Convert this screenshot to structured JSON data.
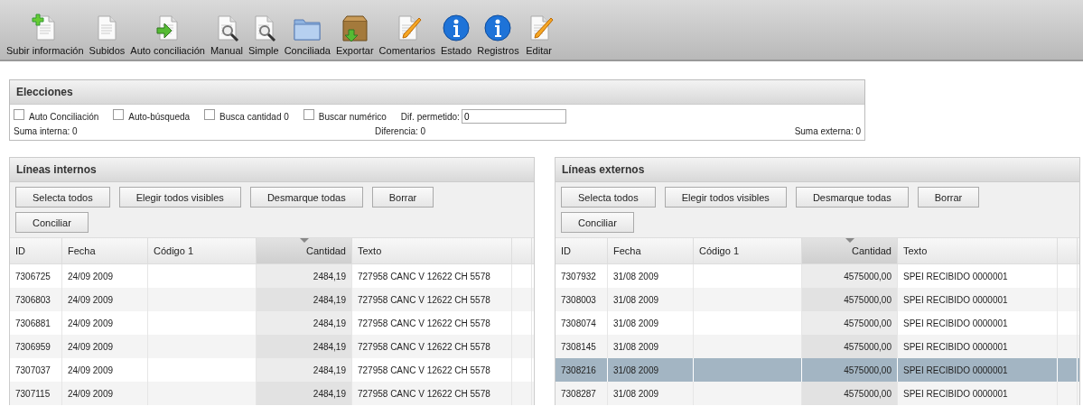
{
  "toolbar": [
    {
      "label": "Subir información",
      "kind": "doc-plus"
    },
    {
      "label": "Subidos",
      "kind": "doc"
    },
    {
      "label": "Auto conciliación",
      "kind": "doc-arrow"
    },
    {
      "label": "Manual",
      "kind": "doc-search"
    },
    {
      "label": "Simple",
      "kind": "doc-search"
    },
    {
      "label": "Conciliada",
      "kind": "folder"
    },
    {
      "label": "Exportar",
      "kind": "box"
    },
    {
      "label": "Comentarios",
      "kind": "doc-pencil"
    },
    {
      "label": "Estado",
      "kind": "info"
    },
    {
      "label": "Registros",
      "kind": "info"
    },
    {
      "label": "Editar",
      "kind": "doc-pencil"
    }
  ],
  "options": {
    "title": "Elecciones",
    "checkboxes": [
      {
        "label": "Auto Conciliación",
        "checked": false
      },
      {
        "label": "Auto-búsqueda",
        "checked": false
      },
      {
        "label": "Busca cantidad 0",
        "checked": false
      },
      {
        "label": "Buscar numérico",
        "checked": false
      }
    ],
    "tolerance": {
      "label": "Dif. permetido:",
      "value": "0"
    },
    "internal_sum": "Suma interna: 0",
    "difference": "Diferencia: 0",
    "external_sum": "Suma externa: 0"
  },
  "panels": [
    {
      "title": "Líneas internos",
      "buttons": [
        "Selecta todos",
        "Elegir todos visibles",
        "Desmarque todas",
        "Borrar",
        "Conciliar"
      ],
      "columns": [
        {
          "label": "ID",
          "sorted": false
        },
        {
          "label": "Fecha",
          "sorted": false
        },
        {
          "label": "Código 1",
          "sorted": false
        },
        {
          "label": "Cantidad",
          "sorted": true
        },
        {
          "label": "Texto",
          "sorted": false
        }
      ],
      "rows": [
        {
          "cells": [
            "7306725",
            "24/09 2009",
            "",
            "2484,19",
            "727958 CANC V 12622 CH 5578"
          ],
          "selected": false
        },
        {
          "cells": [
            "7306803",
            "24/09 2009",
            "",
            "2484,19",
            "727958 CANC V 12622 CH 5578"
          ],
          "selected": false
        },
        {
          "cells": [
            "7306881",
            "24/09 2009",
            "",
            "2484,19",
            "727958 CANC V 12622 CH 5578"
          ],
          "selected": false
        },
        {
          "cells": [
            "7306959",
            "24/09 2009",
            "",
            "2484,19",
            "727958 CANC V 12622 CH 5578"
          ],
          "selected": false
        },
        {
          "cells": [
            "7307037",
            "24/09 2009",
            "",
            "2484,19",
            "727958 CANC V 12622 CH 5578"
          ],
          "selected": false
        },
        {
          "cells": [
            "7307115",
            "24/09 2009",
            "",
            "2484,19",
            "727958 CANC V 12622 CH 5578"
          ],
          "selected": false
        }
      ]
    },
    {
      "title": "Líneas externos",
      "buttons": [
        "Selecta todos",
        "Elegir todos visibles",
        "Desmarque todas",
        "Borrar",
        "Conciliar"
      ],
      "columns": [
        {
          "label": "ID",
          "sorted": false
        },
        {
          "label": "Fecha",
          "sorted": false
        },
        {
          "label": "Código 1",
          "sorted": false
        },
        {
          "label": "Cantidad",
          "sorted": true
        },
        {
          "label": "Texto",
          "sorted": false
        }
      ],
      "rows": [
        {
          "cells": [
            "7307932",
            "31/08 2009",
            "",
            "4575000,00",
            "SPEI RECIBIDO 0000001"
          ],
          "selected": false
        },
        {
          "cells": [
            "7308003",
            "31/08 2009",
            "",
            "4575000,00",
            "SPEI RECIBIDO 0000001"
          ],
          "selected": false
        },
        {
          "cells": [
            "7308074",
            "31/08 2009",
            "",
            "4575000,00",
            "SPEI RECIBIDO 0000001"
          ],
          "selected": false
        },
        {
          "cells": [
            "7308145",
            "31/08 2009",
            "",
            "4575000,00",
            "SPEI RECIBIDO 0000001"
          ],
          "selected": false
        },
        {
          "cells": [
            "7308216",
            "31/08 2009",
            "",
            "4575000,00",
            "SPEI RECIBIDO 0000001"
          ],
          "selected": true
        },
        {
          "cells": [
            "7308287",
            "31/08 2009",
            "",
            "4575000,00",
            "SPEI RECIBIDO 0000001"
          ],
          "selected": false
        }
      ]
    }
  ]
}
